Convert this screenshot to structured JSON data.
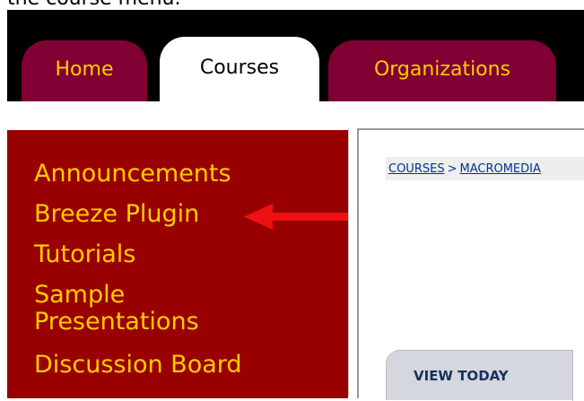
{
  "caption": "the course menu.",
  "tabs": [
    {
      "label": "Home"
    },
    {
      "label": "Courses"
    },
    {
      "label": "Organizations"
    }
  ],
  "sidebar": {
    "items": [
      {
        "label": "Announcements"
      },
      {
        "label": "Breeze Plugin"
      },
      {
        "label": "Tutorials"
      },
      {
        "label": "Sample Presentations"
      },
      {
        "label": "Discussion Board"
      }
    ]
  },
  "breadcrumb": {
    "courses": "COURSES",
    "separator": ">",
    "current": "MACROMEDIA"
  },
  "content_tab": {
    "label": "VIEW TODAY"
  },
  "colors": {
    "tab_inactive": "#800033",
    "tab_text": "#FFCC00",
    "sidebar_bg": "#990000",
    "arrow": "#EE1111"
  },
  "annotation": {
    "icon": "red-arrow-icon"
  }
}
